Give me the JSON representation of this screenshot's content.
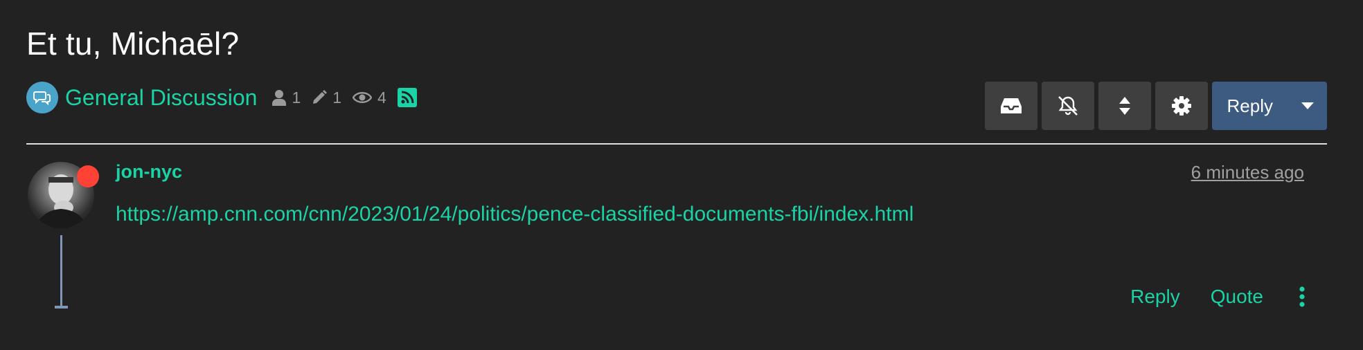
{
  "topic": {
    "title": "Et tu, Michaēl?"
  },
  "category": {
    "name": "General Discussion",
    "icon": "comments-icon",
    "color": "#4aa3c9"
  },
  "stats": {
    "posters": "1",
    "posts": "1",
    "views": "4"
  },
  "toolbar": {
    "buttons": [
      "inbox-icon",
      "bell-slash-icon",
      "sort-icon",
      "gear-icon"
    ],
    "reply_label": "Reply"
  },
  "post": {
    "author": "jon-nyc",
    "time": "6 minutes ago",
    "link": "https://amp.cnn.com/cnn/2023/01/24/politics/pence-classified-documents-fbi/index.html",
    "status_color": "#ff4136",
    "actions": {
      "reply": "Reply",
      "quote": "Quote"
    }
  },
  "colors": {
    "accent": "#1ad3a6",
    "primary_button": "#3d5a80",
    "background": "#222222"
  }
}
